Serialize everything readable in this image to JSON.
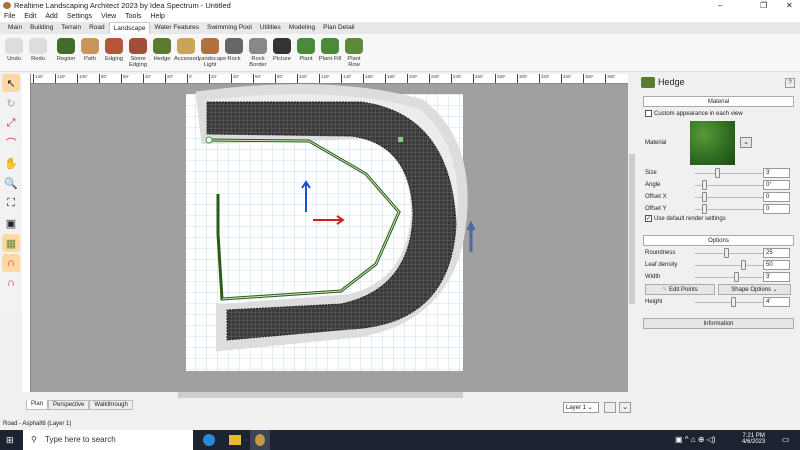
{
  "window": {
    "title": "Realtime Landscaping Architect 2023 by Idea Spectrum - Untitled"
  },
  "menu": [
    "File",
    "Edit",
    "Add",
    "Settings",
    "View",
    "Tools",
    "Help"
  ],
  "tabs": [
    "Main",
    "Building",
    "Terrain",
    "Road",
    "Landscape",
    "Water Features",
    "Swimming Pool",
    "Utilities",
    "Modeling",
    "Plan Detail"
  ],
  "active_tab": "Landscape",
  "ribbon": [
    {
      "label": "Undo",
      "color": "#dddddd"
    },
    {
      "label": "Redo",
      "color": "#dddddd"
    },
    {
      "label": "Region",
      "color": "#3f6e2a"
    },
    {
      "label": "Path",
      "color": "#c9955a"
    },
    {
      "label": "Edging",
      "color": "#b5553a"
    },
    {
      "label": "Stone Edging",
      "color": "#a0503a"
    },
    {
      "label": "Hedge",
      "color": "#5a7a2e"
    },
    {
      "label": "Accessory",
      "color": "#c9a45a"
    },
    {
      "label": "Landscape Light",
      "color": "#b07040"
    },
    {
      "label": "Rock",
      "color": "#666666"
    },
    {
      "label": "Rock Border",
      "color": "#888888"
    },
    {
      "label": "Picture",
      "color": "#333333"
    },
    {
      "label": "Plant",
      "color": "#4a8a3a"
    },
    {
      "label": "Plant Fill",
      "color": "#4a8a3a"
    },
    {
      "label": "Plant Row",
      "color": "#5a8a3a"
    }
  ],
  "ruler_labels": [
    "140'",
    "120'",
    "100'",
    "80'",
    "60'",
    "40'",
    "20'",
    "0'",
    "20'",
    "40'",
    "60'",
    "80'",
    "100'",
    "120'",
    "140'",
    "160'",
    "180'",
    "200'",
    "220'",
    "240'",
    "260'",
    "280'",
    "300'",
    "320'",
    "340'",
    "360'",
    "380'"
  ],
  "view_tabs": [
    "Plan",
    "Perspective",
    "Walkthrough"
  ],
  "layer": "Layer 1",
  "panel": {
    "title": "Hedge",
    "help": "?",
    "material_section": "Material",
    "custom_appearance": "Custom appearance in each view",
    "custom_checked": false,
    "material_label": "Material",
    "material_rows": [
      {
        "label": "Size",
        "value": "3'",
        "pos": 0.3
      },
      {
        "label": "Angle",
        "value": "0°",
        "pos": 0.1
      },
      {
        "label": "Offset X",
        "value": "0",
        "pos": 0.1
      },
      {
        "label": "Offset Y",
        "value": "0",
        "pos": 0.1
      }
    ],
    "default_render": "Use default render settings",
    "default_render_checked": true,
    "options_section": "Options",
    "option_rows": [
      {
        "label": "Roundness",
        "value": "25",
        "pos": 0.45
      },
      {
        "label": "Leaf density",
        "value": "50",
        "pos": 0.7
      },
      {
        "label": "Width",
        "value": "3'",
        "pos": 0.6
      }
    ],
    "edit_points": "Edit Points",
    "shape_options": "Shape Options",
    "height": {
      "label": "Height",
      "value": "4'",
      "pos": 0.55
    },
    "information": "Information"
  },
  "status": "Road - Asphalt6 (Layer 1)",
  "taskbar": {
    "search_placeholder": "Type here to search",
    "time": "7:21 PM",
    "date": "4/6/2023"
  }
}
